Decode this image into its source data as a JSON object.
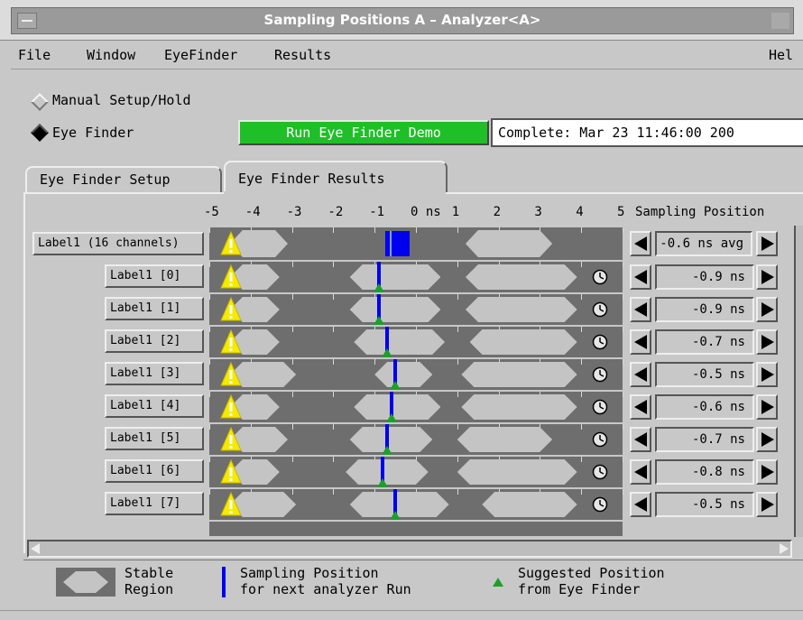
{
  "window": {
    "title": "Sampling Positions A – Analyzer<A>"
  },
  "menubar": {
    "items": [
      "File",
      "Window",
      "EyeFinder",
      "Results"
    ],
    "help": "Hel"
  },
  "mode": {
    "manual_label": "Manual Setup/Hold",
    "eyefinder_label": "Eye Finder",
    "selected": "Eye Finder"
  },
  "run_button_label": "Run Eye Finder Demo",
  "status_text": "Complete: Mar 23 11:46:00 200",
  "tabs": [
    {
      "label": "Eye Finder Setup",
      "active": false
    },
    {
      "label": "Eye Finder Results",
      "active": true
    }
  ],
  "axis": {
    "ticks": [
      "-5",
      "-4",
      "-3",
      "-2",
      "-1",
      "0 ns",
      "1",
      "2",
      "3",
      "4",
      "5"
    ],
    "min": -5,
    "max": 5
  },
  "sampling_header": "Sampling Position",
  "summary": {
    "label": "Label1 (16 channels)",
    "value": "-0.6 ns avg",
    "stable_regions": [
      [
        -4.5,
        -3.1
      ],
      [
        1.2,
        3.3
      ]
    ],
    "sampling_range": [
      -0.75,
      -0.15
    ]
  },
  "rows": [
    {
      "label": "Label1  [0]",
      "value": "-0.9 ns",
      "position": -0.9,
      "suggested": -0.9,
      "stable_regions": [
        [
          -4.5,
          -3.3
        ],
        [
          -1.6,
          0.6
        ],
        [
          1.2,
          3.9
        ]
      ]
    },
    {
      "label": "Label1  [1]",
      "value": "-0.9 ns",
      "position": -0.9,
      "suggested": -0.9,
      "stable_regions": [
        [
          -4.5,
          -3.3
        ],
        [
          -1.6,
          0.6
        ],
        [
          1.2,
          3.9
        ]
      ]
    },
    {
      "label": "Label1  [2]",
      "value": "-0.7 ns",
      "position": -0.7,
      "suggested": -0.7,
      "stable_regions": [
        [
          -4.5,
          -3.3
        ],
        [
          -1.5,
          0.7
        ],
        [
          1.3,
          3.9
        ]
      ]
    },
    {
      "label": "Label1  [3]",
      "value": "-0.5 ns",
      "position": -0.5,
      "suggested": -0.5,
      "stable_regions": [
        [
          -4.5,
          -2.9
        ],
        [
          -1.0,
          0.4
        ],
        [
          1.1,
          3.9
        ]
      ]
    },
    {
      "label": "Label1  [4]",
      "value": "-0.6 ns",
      "position": -0.6,
      "suggested": -0.6,
      "stable_regions": [
        [
          -4.5,
          -3.3
        ],
        [
          -1.5,
          0.6
        ],
        [
          1.1,
          3.9
        ]
      ]
    },
    {
      "label": "Label1  [5]",
      "value": "-0.7 ns",
      "position": -0.7,
      "suggested": -0.7,
      "stable_regions": [
        [
          -4.5,
          -3.1
        ],
        [
          -1.6,
          0.4
        ],
        [
          1.0,
          3.3
        ]
      ]
    },
    {
      "label": "Label1  [6]",
      "value": "-0.8 ns",
      "position": -0.8,
      "suggested": -0.8,
      "stable_regions": [
        [
          -4.5,
          -3.3
        ],
        [
          -1.7,
          0.3
        ],
        [
          1.0,
          3.9
        ]
      ]
    },
    {
      "label": "Label1  [7]",
      "value": "-0.5 ns",
      "position": -0.5,
      "suggested": -0.5,
      "stable_regions": [
        [
          -4.5,
          -2.9
        ],
        [
          -1.6,
          0.8
        ],
        [
          1.6,
          3.9
        ]
      ]
    }
  ],
  "legend": {
    "stable": [
      "Stable",
      "Region"
    ],
    "sampling": [
      "Sampling Position",
      "for next analyzer Run"
    ],
    "suggested": [
      "Suggested Position",
      "from Eye Finder"
    ]
  },
  "colors": {
    "run_button": "#1fbf27",
    "sampling_marker": "#0000ee",
    "suggested_marker": "#1f9e2c",
    "warning_icon": "#f5ea00",
    "plot_background": "#6e6e6e",
    "stable_region": "#c4c4c4"
  }
}
